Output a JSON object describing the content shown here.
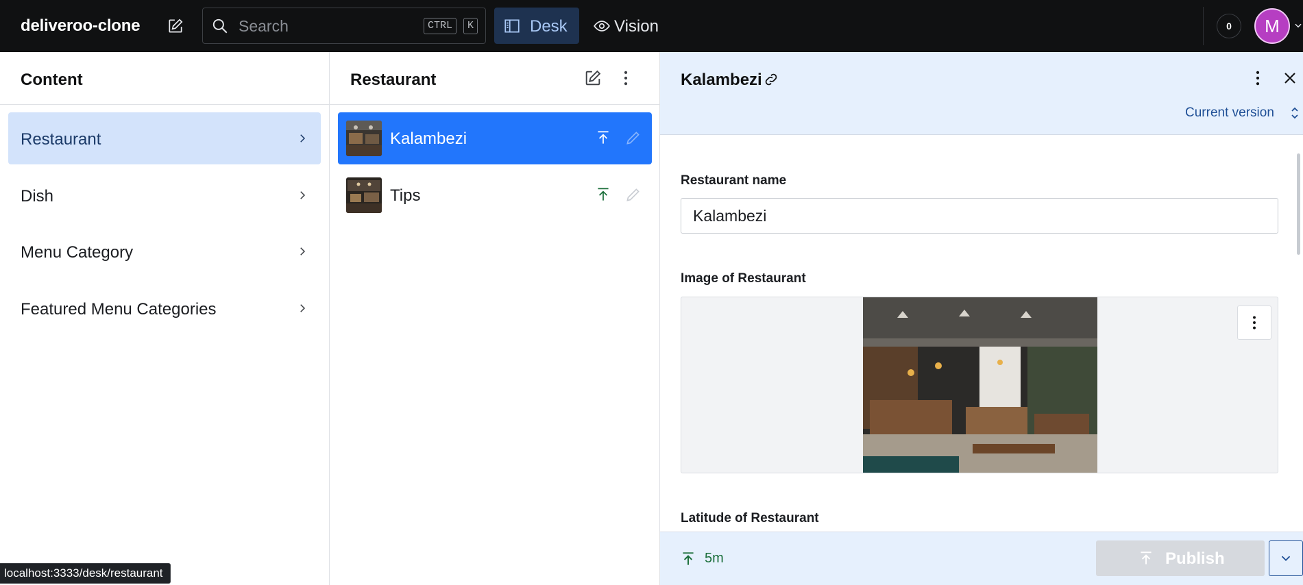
{
  "app": {
    "brand": "deliveroo-clone"
  },
  "topbar": {
    "search_placeholder": "Search",
    "shortcut_ctrl": "CTRL",
    "shortcut_k": "K",
    "tools": [
      {
        "label": "Desk",
        "icon": "desk-icon",
        "active": true
      },
      {
        "label": "Vision",
        "icon": "eye-icon",
        "active": false
      }
    ],
    "notification_count": "0",
    "avatar_initial": "M"
  },
  "content_pane": {
    "title": "Content",
    "items": [
      {
        "label": "Restaurant",
        "selected": true
      },
      {
        "label": "Dish",
        "selected": false
      },
      {
        "label": "Menu Category",
        "selected": false
      },
      {
        "label": "Featured Menu Categories",
        "selected": false
      }
    ]
  },
  "list_pane": {
    "title": "Restaurant",
    "documents": [
      {
        "label": "Kalambezi",
        "selected": true
      },
      {
        "label": "Tips",
        "selected": false
      }
    ]
  },
  "document": {
    "title": "Kalambezi",
    "version_label": "Current version",
    "fields": {
      "name_label": "Restaurant name",
      "name_value": "Kalambezi",
      "image_label": "Image of Restaurant",
      "latitude_label": "Latitude of Restaurant"
    },
    "footer": {
      "last_published": "5m",
      "publish_label": "Publish"
    }
  },
  "status_url": "localhost:3333/desk/restaurant",
  "colors": {
    "navbar_bg": "#101112",
    "accent_blue": "#2276fc",
    "selected_nav": "#d3e3fb",
    "doc_header_bg": "#e6f0fd",
    "published_green": "#1a6e3a",
    "avatar": "#b63ec2"
  }
}
